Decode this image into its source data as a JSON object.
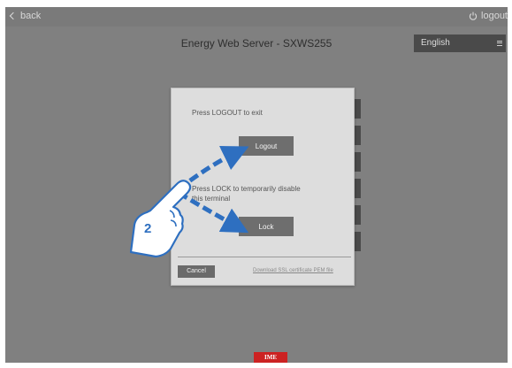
{
  "topbar": {
    "back_label": "back",
    "logout_label": "logout"
  },
  "header": {
    "title": "Energy Web Server - SXWS255",
    "language": "English"
  },
  "modal": {
    "logout_text": "Press LOGOUT to exit",
    "logout_button": "Logout",
    "lock_text_line1": "Press LOCK to temporarily disable",
    "lock_text_line2": "this terminal",
    "lock_button": "Lock",
    "cancel_button": "Cancel",
    "ssl_link": "Download SSL certificate PEM file"
  },
  "annotation": {
    "step_number": "2",
    "arrow_color": "#2e6fc0",
    "hand_color": "#2e6fc0"
  },
  "footer": {
    "brand": "IME",
    "brand_color": "#cc2222"
  },
  "icons": {
    "back": "chevron-left-icon",
    "logout": "power-icon",
    "language_menu": "menu-icon",
    "hand": "pointing-hand-icon"
  }
}
